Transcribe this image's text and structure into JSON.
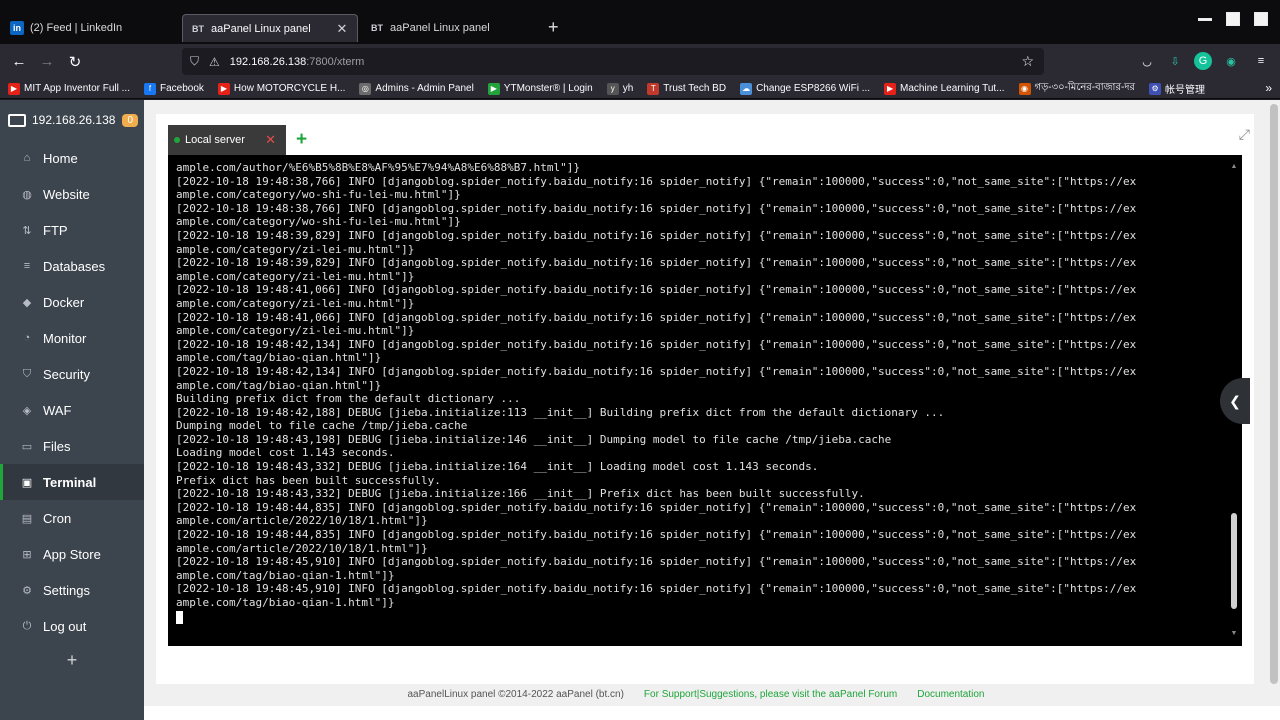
{
  "browser": {
    "tabs": [
      {
        "favicon": "in",
        "title": "(2) Feed | LinkedIn",
        "active": false
      },
      {
        "favicon": "BT",
        "title": "aaPanel Linux panel",
        "active": true
      },
      {
        "favicon": "BT",
        "title": "aaPanel Linux panel",
        "active": false
      }
    ],
    "new_tab_label": "+",
    "url_host": "192.168.26.138",
    "url_path": ":7800/xterm",
    "bookmarks": [
      {
        "label": "MIT App Inventor Full ...",
        "color": "#e62117",
        "glyph": "▶"
      },
      {
        "label": "Facebook",
        "color": "#1877f2",
        "glyph": "f"
      },
      {
        "label": "How MOTORCYCLE H...",
        "color": "#e62117",
        "glyph": "▶"
      },
      {
        "label": "Admins - Admin Panel",
        "color": "#6b6b6b",
        "glyph": "◎"
      },
      {
        "label": "YTMonster® | Login",
        "color": "#22a33b",
        "glyph": "▶"
      },
      {
        "label": "yh",
        "color": "#555555",
        "glyph": "y"
      },
      {
        "label": "Trust Tech BD",
        "color": "#c0392b",
        "glyph": "T"
      },
      {
        "label": "Change ESP8266 WiFi ...",
        "color": "#4a90d9",
        "glyph": "☁"
      },
      {
        "label": "Machine Learning Tut...",
        "color": "#e62117",
        "glyph": "▶"
      },
      {
        "label": "গড়-৩০-মিনের-বাজার-দর",
        "color": "#d35400",
        "glyph": "◉"
      },
      {
        "label": "帐号管理",
        "color": "#3f51b5",
        "glyph": "⚙"
      }
    ]
  },
  "sidebar": {
    "host": "192.168.26.138",
    "badge": "0",
    "items": [
      {
        "label": "Home",
        "icon": "⌂",
        "active": false
      },
      {
        "label": "Website",
        "icon": "◍",
        "active": false
      },
      {
        "label": "FTP",
        "icon": "⇅",
        "active": false
      },
      {
        "label": "Databases",
        "icon": "≡",
        "active": false
      },
      {
        "label": "Docker",
        "icon": "◆",
        "active": false
      },
      {
        "label": "Monitor",
        "icon": "◔",
        "active": false
      },
      {
        "label": "Security",
        "icon": "⛉",
        "active": false
      },
      {
        "label": "WAF",
        "icon": "◈",
        "active": false
      },
      {
        "label": "Files",
        "icon": "▭",
        "active": false
      },
      {
        "label": "Terminal",
        "icon": "▣",
        "active": true
      },
      {
        "label": "Cron",
        "icon": "▤",
        "active": false
      },
      {
        "label": "App Store",
        "icon": "⊞",
        "active": false
      },
      {
        "label": "Settings",
        "icon": "⚙",
        "active": false
      },
      {
        "label": "Log out",
        "icon": "⏻",
        "active": false
      }
    ],
    "add_label": "+"
  },
  "terminal": {
    "tab_label": "Local server",
    "close_label": "✕",
    "add_label": "+",
    "lines": [
      "ample.com/author/%E6%B5%8B%E8%AF%95%E7%94%A8%E6%88%B7.html\"]}",
      "[2022-10-18 19:48:38,766] INFO [djangoblog.spider_notify.baidu_notify:16 spider_notify] {\"remain\":100000,\"success\":0,\"not_same_site\":[\"https://ex",
      "ample.com/category/wo-shi-fu-lei-mu.html\"]}",
      "[2022-10-18 19:48:38,766] INFO [djangoblog.spider_notify.baidu_notify:16 spider_notify] {\"remain\":100000,\"success\":0,\"not_same_site\":[\"https://ex",
      "ample.com/category/wo-shi-fu-lei-mu.html\"]}",
      "[2022-10-18 19:48:39,829] INFO [djangoblog.spider_notify.baidu_notify:16 spider_notify] {\"remain\":100000,\"success\":0,\"not_same_site\":[\"https://ex",
      "ample.com/category/zi-lei-mu.html\"]}",
      "[2022-10-18 19:48:39,829] INFO [djangoblog.spider_notify.baidu_notify:16 spider_notify] {\"remain\":100000,\"success\":0,\"not_same_site\":[\"https://ex",
      "ample.com/category/zi-lei-mu.html\"]}",
      "[2022-10-18 19:48:41,066] INFO [djangoblog.spider_notify.baidu_notify:16 spider_notify] {\"remain\":100000,\"success\":0,\"not_same_site\":[\"https://ex",
      "ample.com/category/zi-lei-mu.html\"]}",
      "[2022-10-18 19:48:41,066] INFO [djangoblog.spider_notify.baidu_notify:16 spider_notify] {\"remain\":100000,\"success\":0,\"not_same_site\":[\"https://ex",
      "ample.com/category/zi-lei-mu.html\"]}",
      "[2022-10-18 19:48:42,134] INFO [djangoblog.spider_notify.baidu_notify:16 spider_notify] {\"remain\":100000,\"success\":0,\"not_same_site\":[\"https://ex",
      "ample.com/tag/biao-qian.html\"]}",
      "[2022-10-18 19:48:42,134] INFO [djangoblog.spider_notify.baidu_notify:16 spider_notify] {\"remain\":100000,\"success\":0,\"not_same_site\":[\"https://ex",
      "ample.com/tag/biao-qian.html\"]}",
      "Building prefix dict from the default dictionary ...",
      "[2022-10-18 19:48:42,188] DEBUG [jieba.initialize:113 __init__] Building prefix dict from the default dictionary ...",
      "Dumping model to file cache /tmp/jieba.cache",
      "[2022-10-18 19:48:43,198] DEBUG [jieba.initialize:146 __init__] Dumping model to file cache /tmp/jieba.cache",
      "Loading model cost 1.143 seconds.",
      "[2022-10-18 19:48:43,332] DEBUG [jieba.initialize:164 __init__] Loading model cost 1.143 seconds.",
      "Prefix dict has been built successfully.",
      "[2022-10-18 19:48:43,332] DEBUG [jieba.initialize:166 __init__] Prefix dict has been built successfully.",
      "[2022-10-18 19:48:44,835] INFO [djangoblog.spider_notify.baidu_notify:16 spider_notify] {\"remain\":100000,\"success\":0,\"not_same_site\":[\"https://ex",
      "ample.com/article/2022/10/18/1.html\"]}",
      "[2022-10-18 19:48:44,835] INFO [djangoblog.spider_notify.baidu_notify:16 spider_notify] {\"remain\":100000,\"success\":0,\"not_same_site\":[\"https://ex",
      "ample.com/article/2022/10/18/1.html\"]}",
      "[2022-10-18 19:48:45,910] INFO [djangoblog.spider_notify.baidu_notify:16 spider_notify] {\"remain\":100000,\"success\":0,\"not_same_site\":[\"https://ex",
      "ample.com/tag/biao-qian-1.html\"]}",
      "[2022-10-18 19:48:45,910] INFO [djangoblog.spider_notify.baidu_notify:16 spider_notify] {\"remain\":100000,\"success\":0,\"not_same_site\":[\"https://ex",
      "ample.com/tag/biao-qian-1.html\"]}"
    ]
  },
  "footer": {
    "copyright": "aaPanelLinux panel ©2014-2022 aaPanel (bt.cn)",
    "support_link": "For Support|Suggestions, please visit the aaPanel Forum",
    "docs_link": "Documentation"
  },
  "colors": {
    "accent": "#20a53a",
    "sidebar_bg": "#3c444d",
    "terminal_bg": "#000000",
    "badge": "#f0ad4e"
  }
}
